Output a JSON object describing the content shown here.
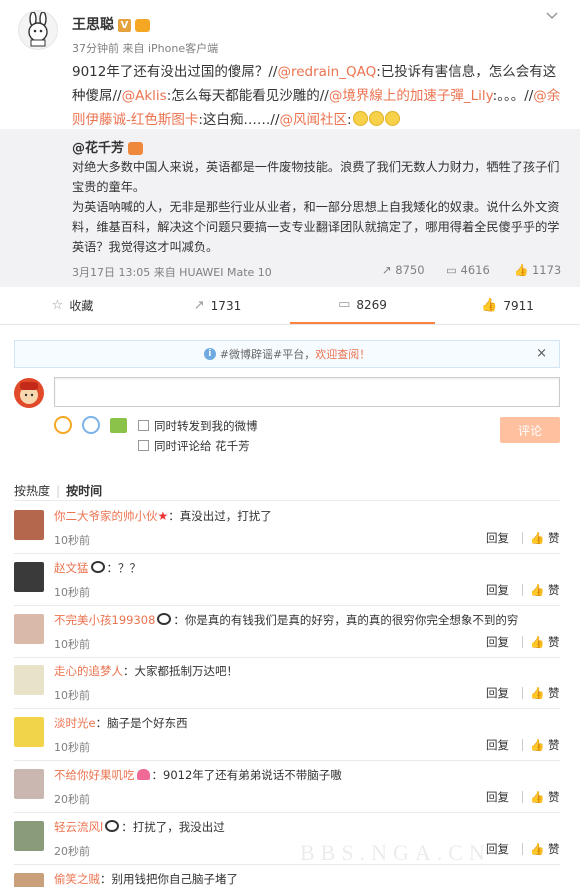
{
  "post": {
    "author": "王思聪",
    "meta": "37分钟前 来自 iPhone客户端",
    "text_parts": [
      {
        "t": "9012年了还有没出过国的傻屌？//",
        "link": false
      },
      {
        "t": "@redrain_QAQ",
        "link": true
      },
      {
        "t": ":已投诉有害信息，怎么会有这种傻屌//",
        "link": false
      },
      {
        "t": "@Aklis",
        "link": true
      },
      {
        "t": ":怎么每天都能看见沙雕的//",
        "link": false
      },
      {
        "t": "@境界線上的加速子彈_Lily",
        "link": true
      },
      {
        "t": ":。。。//",
        "link": false
      },
      {
        "t": "@余则伊藤诚-红色斯图卡",
        "link": true
      },
      {
        "t": ":这白痴……//",
        "link": false
      },
      {
        "t": "@风闻社区",
        "link": true
      },
      {
        "t": ":",
        "link": false
      }
    ]
  },
  "quote": {
    "author": "@花千芳",
    "para1": "对绝大多数中国人来说，英语都是一件废物技能。浪费了我们无数人力财力，牺牲了孩子们宝贵的童年。",
    "para2": "为英语呐喊的人，无非是那些行业从业者，和一部分思想上自我矮化的奴隶。说什么外文资料，维基百科，解决这个问题只要搞一支专业翻译团队就搞定了，哪用得着全民傻乎乎的学英语？我觉得这才叫减负。",
    "footer": "3月17日 13:05 来自 HUAWEI Mate 10",
    "forwards": "8750",
    "comments": "4616",
    "likes": "1173"
  },
  "actions": {
    "favorite": "收藏",
    "forward": "1731",
    "comment": "8269",
    "like": "7911"
  },
  "notice": {
    "prefix": "#微博辟谣#平台，",
    "link": "欢迎查阅！"
  },
  "composer": {
    "option_forward": "同时转发到我的微博",
    "option_comment": "同时评论给 花千芳",
    "submit": "评论"
  },
  "sort": {
    "hot": "按热度",
    "time": "按时间"
  },
  "comments": [
    {
      "user": "你二大爷家的帅小伙",
      "text": "：真没出过，打扰了",
      "time": "10秒前",
      "badge": "star"
    },
    {
      "user": "赵文猛",
      "text": "：？？",
      "time": "10秒前",
      "badge": "panda"
    },
    {
      "user": "不完美小孩199308",
      "text": "：你是真的有钱我们是真的好穷，真的真的很穷你完全想象不到的穷",
      "time": "10秒前",
      "badge": "panda"
    },
    {
      "user": "走心的追梦人",
      "text": "：大家都抵制万达吧！",
      "time": "10秒前",
      "badge": ""
    },
    {
      "user": "淡时光e",
      "text": "：脑子是个好东西",
      "time": "10秒前",
      "badge": ""
    },
    {
      "user": "不给你好果叽吃",
      "text": "：9012年了还有弟弟说话不带脑子嗷",
      "time": "20秒前",
      "badge": "heart"
    },
    {
      "user": "轻云流风l",
      "text": "：打扰了，我没出过",
      "time": "20秒前",
      "badge": "panda"
    },
    {
      "user": "偷笑之贼",
      "text": "：别用钱把你自己脑子堵了",
      "time": "",
      "badge": ""
    }
  ],
  "labels": {
    "reply": "回复",
    "like": "赞"
  },
  "watermark": "BBS.NGA.CN"
}
